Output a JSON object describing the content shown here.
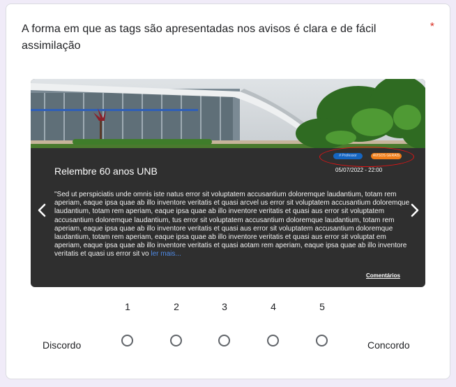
{
  "question": {
    "text": "A forma em que as tags são apresentadas nos avisos é clara e de fácil assimilação",
    "required_mark": "*"
  },
  "notice": {
    "title": "Relembre 60 anos UNB",
    "date": "05/07/2022 - 22:00",
    "tags": [
      "# Professor",
      "AVISOS GERAIS"
    ],
    "body": "\"Sed ut perspiciatis unde omnis iste natus error sit voluptatem accusantium doloremque laudantium, totam rem aperiam, eaque ipsa quae ab illo inventore veritatis et quasi arcvel us error sit voluptatem accusantium doloremque laudantium, totam rem aperiam, eaque ipsa quae ab illo inventore veritatis et quasi aus error sit voluptatem accusantium doloremque laudantium, tus error sit voluptatem accusantium doloremque laudantium, totam rem aperiam, eaque ipsa quae ab illo inventore veritatis et quasi aus error sit voluptatem accusantium doloremque laudantium, totam rem aperiam, eaque ipsa quae ab illo inventore veritatis et quasi aus error sit voluptat em aperiam, eaque ipsa quae ab illo inventore veritatis et quasi aotam rem aperiam, eaque ipsa quae ab illo inventore veritatis et quasi us error sit vo",
    "read_more": "ler mais...",
    "comments_link": "Comentários",
    "prev_icon": "chevron-left-icon",
    "next_icon": "chevron-right-icon",
    "tag_colors": [
      "#1565c0",
      "#ef7d1a"
    ],
    "highlight_color": "#e01515"
  },
  "scale": {
    "numbers": [
      "1",
      "2",
      "3",
      "4",
      "5"
    ],
    "low_label": "Discordo",
    "high_label": "Concordo"
  }
}
